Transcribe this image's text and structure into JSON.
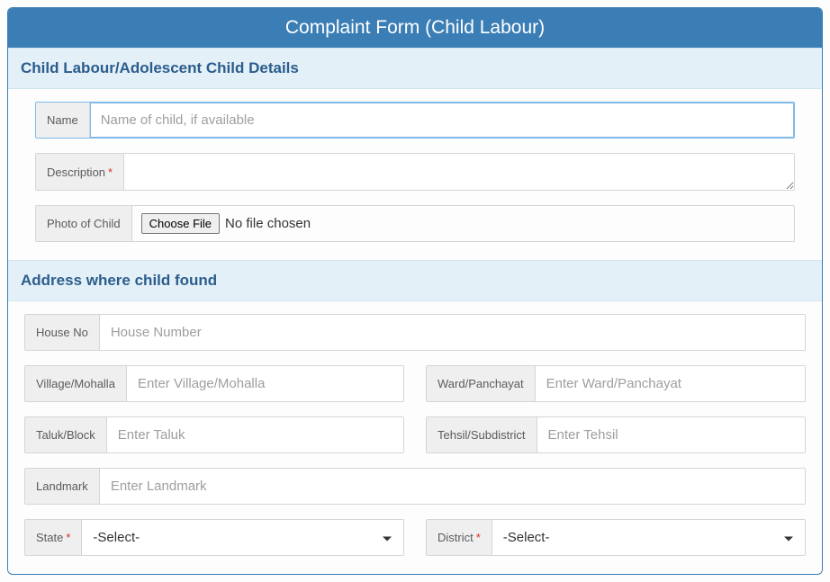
{
  "title": "Complaint Form (Child Labour)",
  "section1": {
    "heading": "Child Labour/Adolescent Child Details",
    "name_label": "Name",
    "name_placeholder": "Name of child, if available",
    "description_label": "Description",
    "photo_label": "Photo of Child",
    "choose_file_label": "Choose File",
    "no_file_text": "No file chosen"
  },
  "section2": {
    "heading": "Address where child found",
    "house_label": "House No",
    "house_placeholder": "House Number",
    "village_label": "Village/Mohalla",
    "village_placeholder": "Enter Village/Mohalla",
    "ward_label": "Ward/Panchayat",
    "ward_placeholder": "Enter Ward/Panchayat",
    "taluk_label": "Taluk/Block",
    "taluk_placeholder": "Enter Taluk",
    "tehsil_label": "Tehsil/Subdistrict",
    "tehsil_placeholder": "Enter Tehsil",
    "landmark_label": "Landmark",
    "landmark_placeholder": "Enter Landmark",
    "state_label": "State",
    "district_label": "District",
    "select_placeholder": "-Select-"
  }
}
